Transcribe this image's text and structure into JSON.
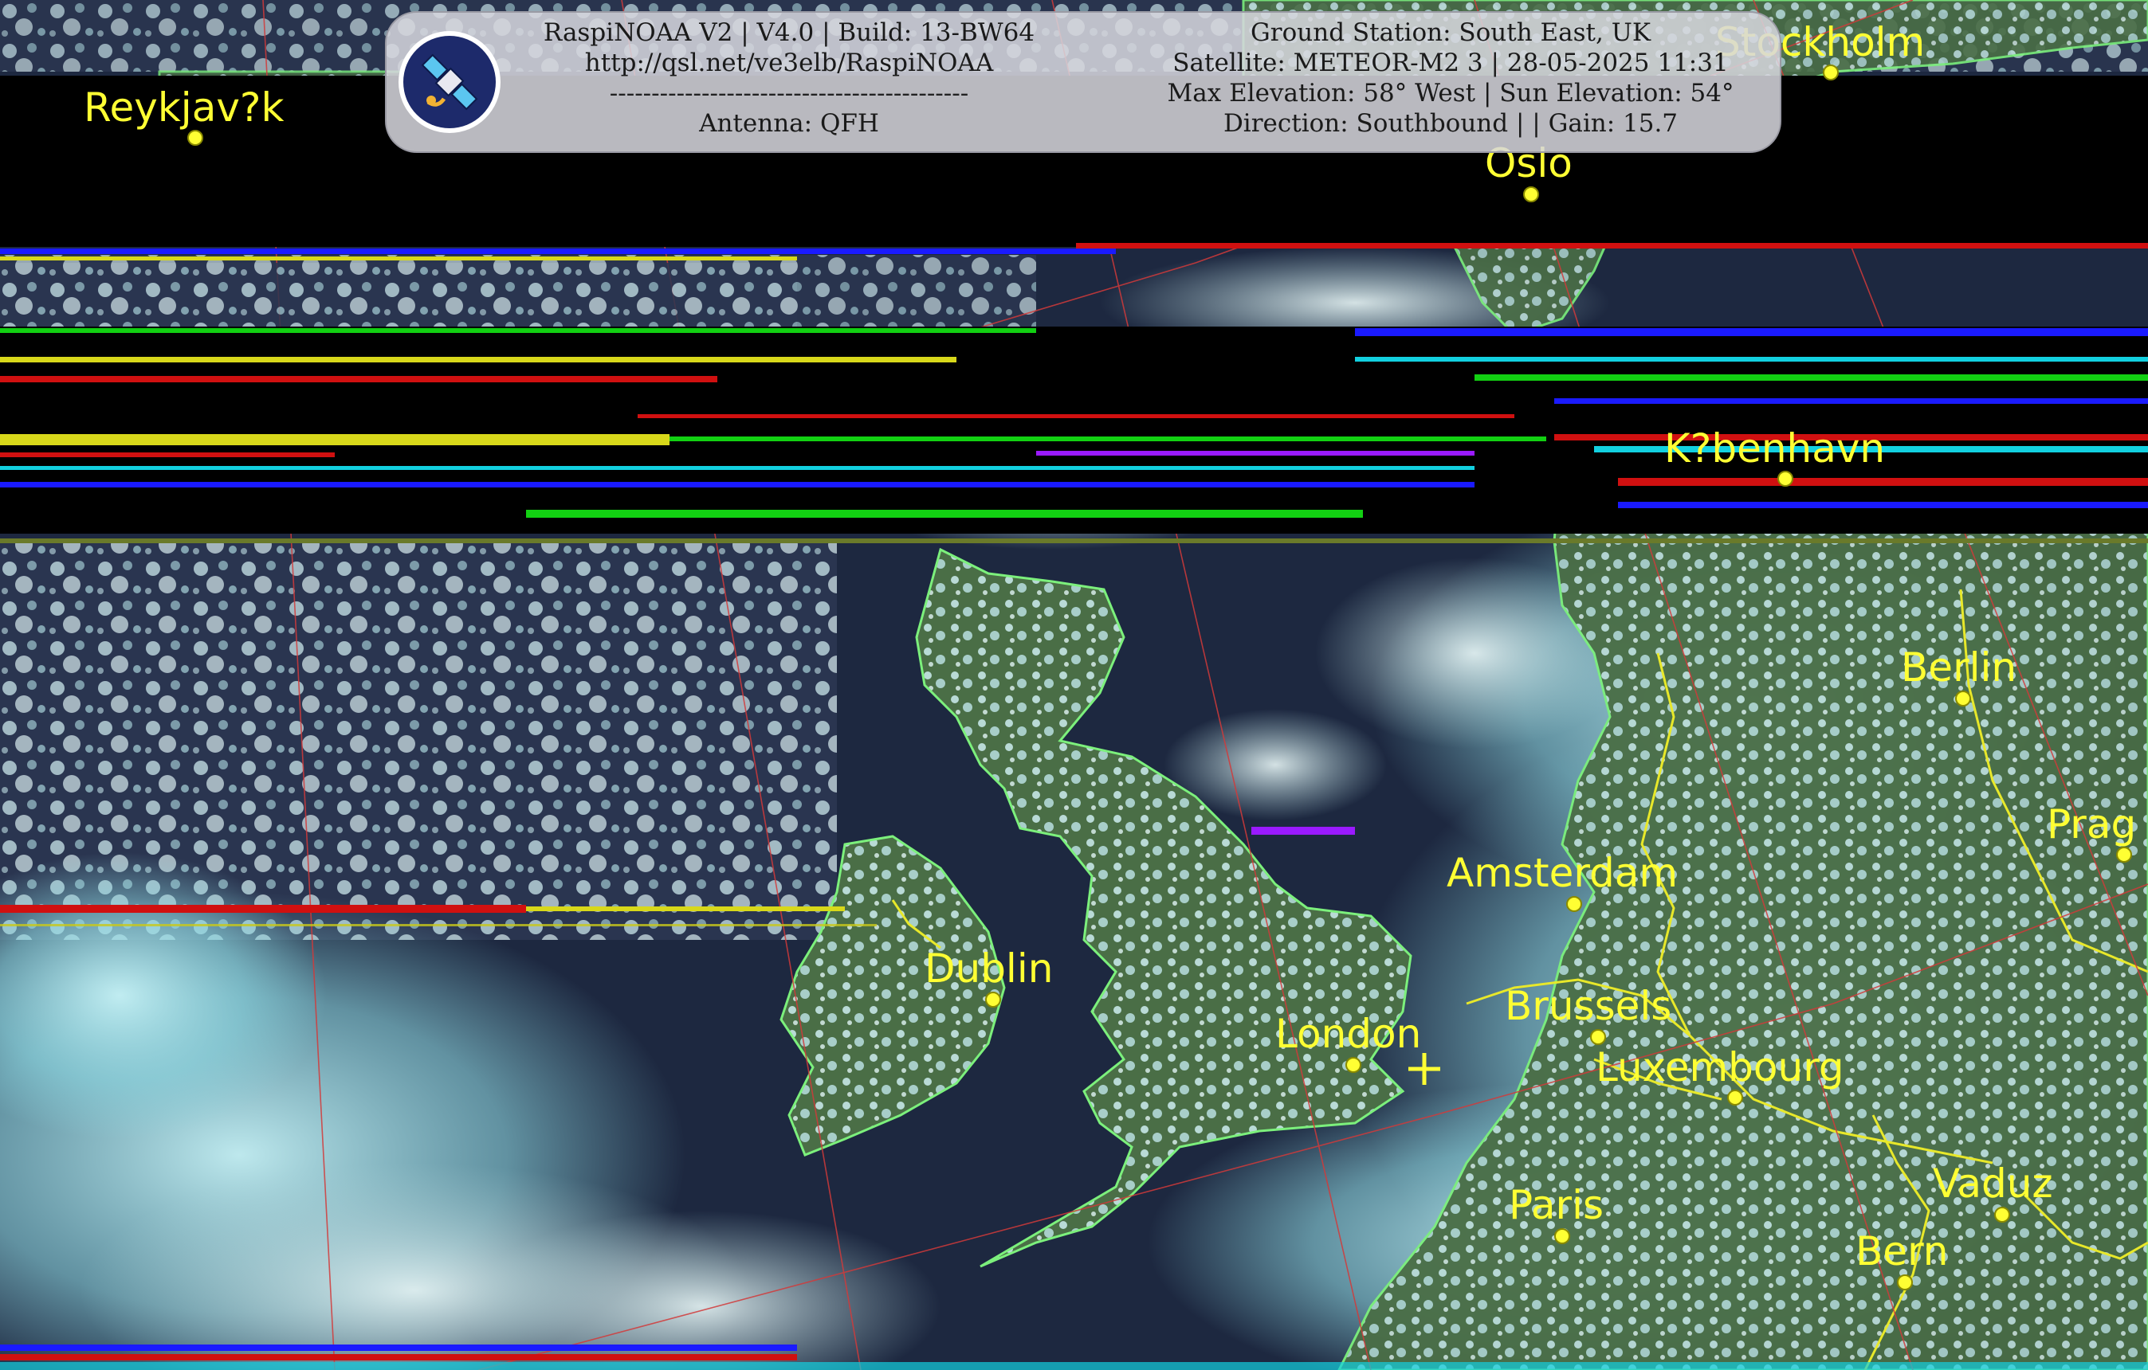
{
  "header": {
    "left_lines": [
      "RaspiNOAA V2 | V4.0 | Build: 13-BW64",
      "http://qsl.net/ve3elb/RaspiNOAA",
      "-------------------------------------------",
      "Antenna: QFH"
    ],
    "right_lines": [
      "Ground Station: South East, UK",
      "Satellite: METEOR-M2 3 | 28-05-2025 11:31",
      "Max Elevation: 58° West | Sun Elevation: 54°",
      "Direction: Southbound | | Gain: 15.7"
    ]
  },
  "logo": {
    "icon": "satellite-icon",
    "bg": "#1d2a6b",
    "ring": "#ffffff"
  },
  "cities": [
    "Reykjav?k",
    "Stockholm",
    "Oslo",
    "K?benhavn",
    "Berlin",
    "Prag",
    "Amsterdam",
    "Dublin",
    "Brussels",
    "London",
    "Luxembourg",
    "Paris",
    "Vaduz",
    "Bern"
  ],
  "colors": {
    "city": "#ffff33",
    "coastline": "#7cf07c",
    "border": "#e8e82a",
    "grid": "#d23a3a",
    "sea": "#1a2438",
    "cloud": "#9fdfe6",
    "land": "#4e7a45"
  },
  "ground_station_marker": "plus-icon"
}
